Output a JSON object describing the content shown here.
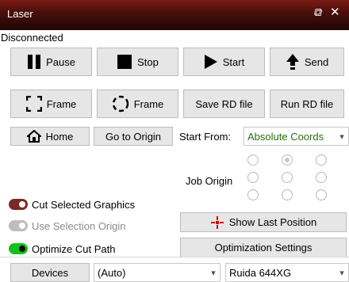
{
  "window": {
    "title": "Laser",
    "float_icon": "⧉",
    "close_icon": "✕"
  },
  "status": "Disconnected",
  "controls": {
    "pause": "Pause",
    "stop": "Stop",
    "start": "Start",
    "send": "Send",
    "frame_rect": "Frame",
    "frame_circle": "Frame",
    "save_rd": "Save RD file",
    "run_rd": "Run RD file",
    "home": "Home",
    "go_to_origin": "Go to Origin"
  },
  "start_from": {
    "label": "Start From:",
    "value": "Absolute Coords"
  },
  "job_origin": {
    "label": "Job Origin",
    "selected": "top-center"
  },
  "options": {
    "cut_selected": {
      "label": "Cut Selected Graphics",
      "state": "on"
    },
    "use_selection_origin": {
      "label": "Use Selection Origin",
      "state": "disabled"
    },
    "optimize_cut_path": {
      "label": "Optimize Cut Path",
      "state": "on"
    }
  },
  "show_last_position": "Show Last Position",
  "optimization_settings": "Optimization Settings",
  "bottom": {
    "devices": "Devices",
    "port": "(Auto)",
    "device": "Ruida 644XG"
  },
  "colors": {
    "title_bar": "#4a0f0b",
    "accent_green": "#2a6e12",
    "toggle_red": "#7a2a26",
    "toggle_green": "#12c21c",
    "origin_marker": "#d40000"
  }
}
